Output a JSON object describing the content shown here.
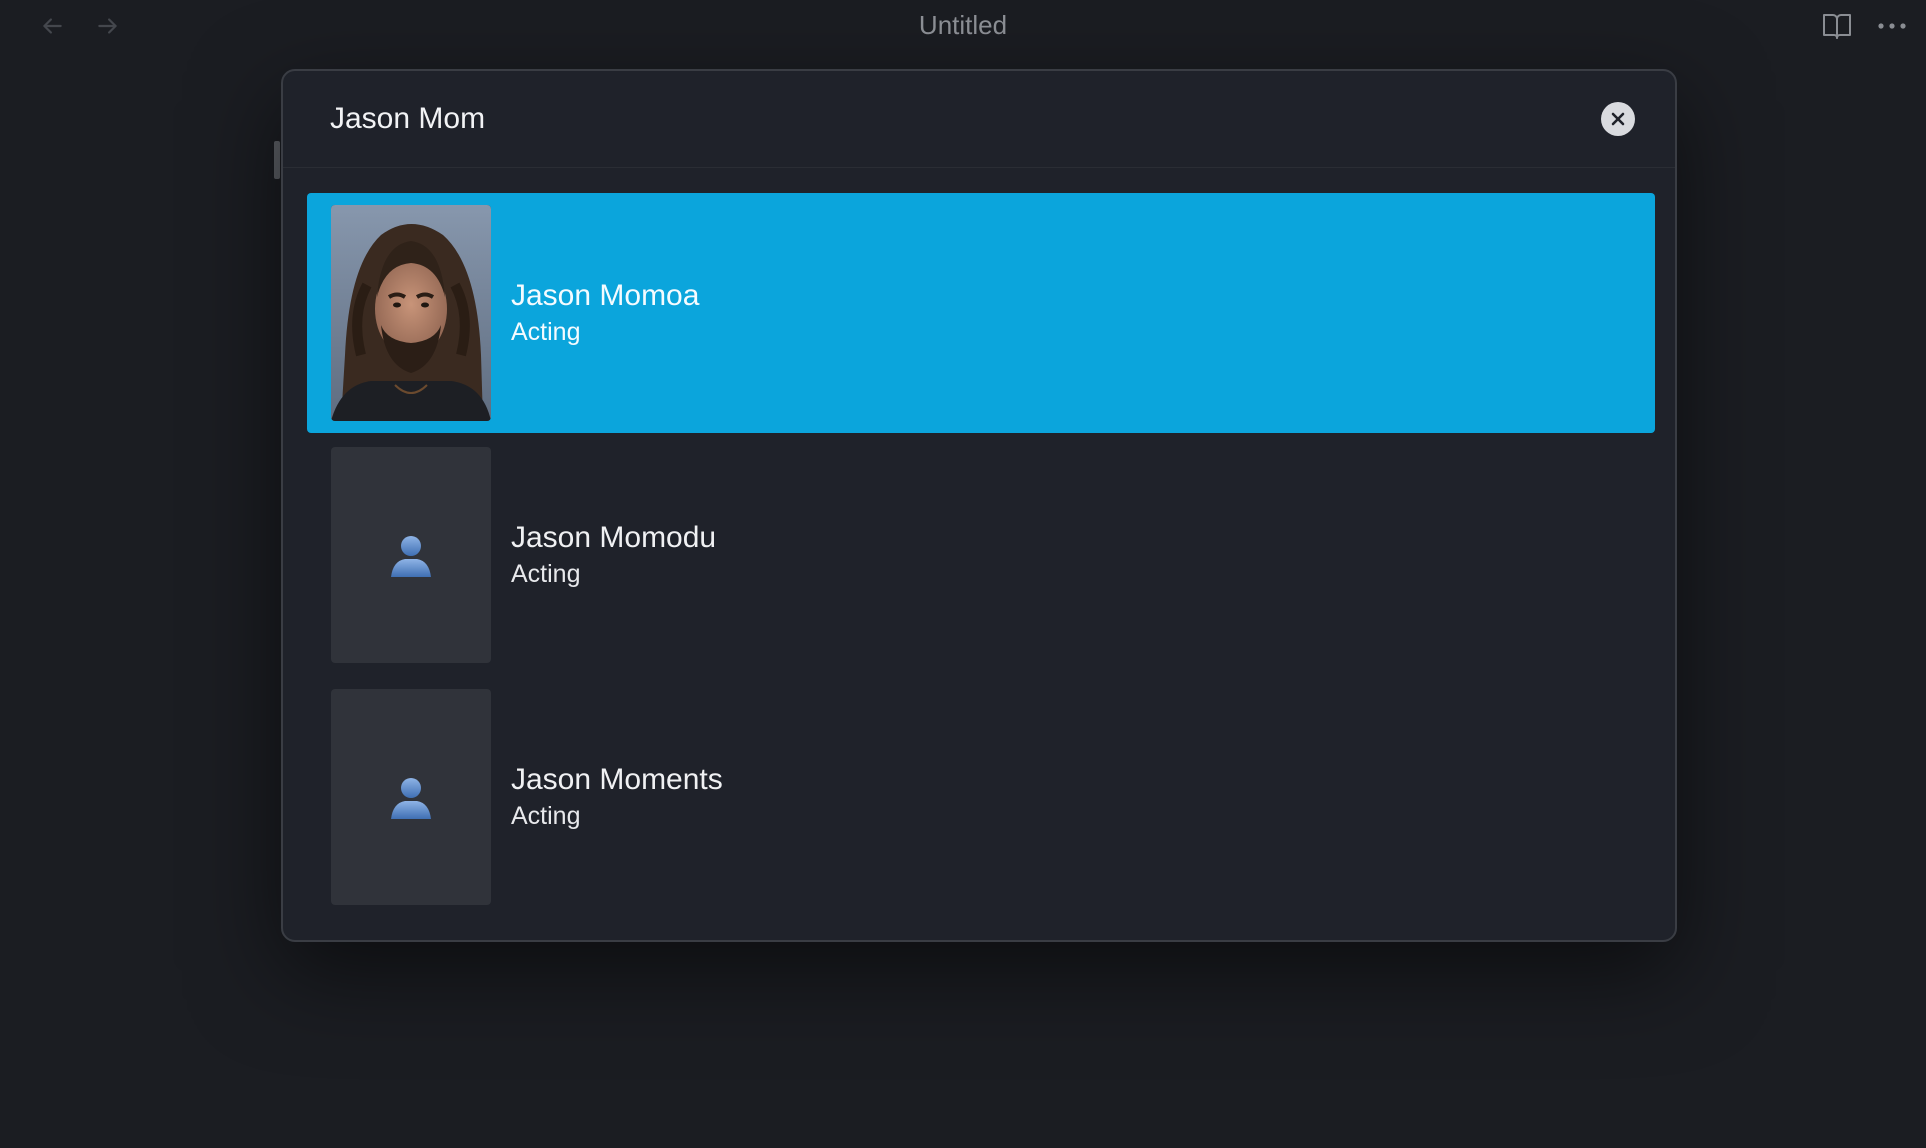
{
  "window": {
    "title": "Untitled"
  },
  "search": {
    "query": "Jason Mom"
  },
  "results": [
    {
      "name": "Jason Momoa",
      "department": "Acting",
      "has_photo": true
    },
    {
      "name": "Jason Momodu",
      "department": "Acting",
      "has_photo": false
    },
    {
      "name": "Jason Moments",
      "department": "Acting",
      "has_photo": false
    }
  ],
  "colors": {
    "selection": "#0ba5dc",
    "background": "#1b1d22",
    "modal": "#1f222a",
    "placeholder_icon": "#5f8fd0"
  },
  "icons": {
    "back": "arrow-left-icon",
    "forward": "arrow-right-icon",
    "reader": "book-open-icon",
    "more": "ellipsis-icon",
    "clear": "close-circle-icon",
    "placeholder": "person-icon"
  }
}
